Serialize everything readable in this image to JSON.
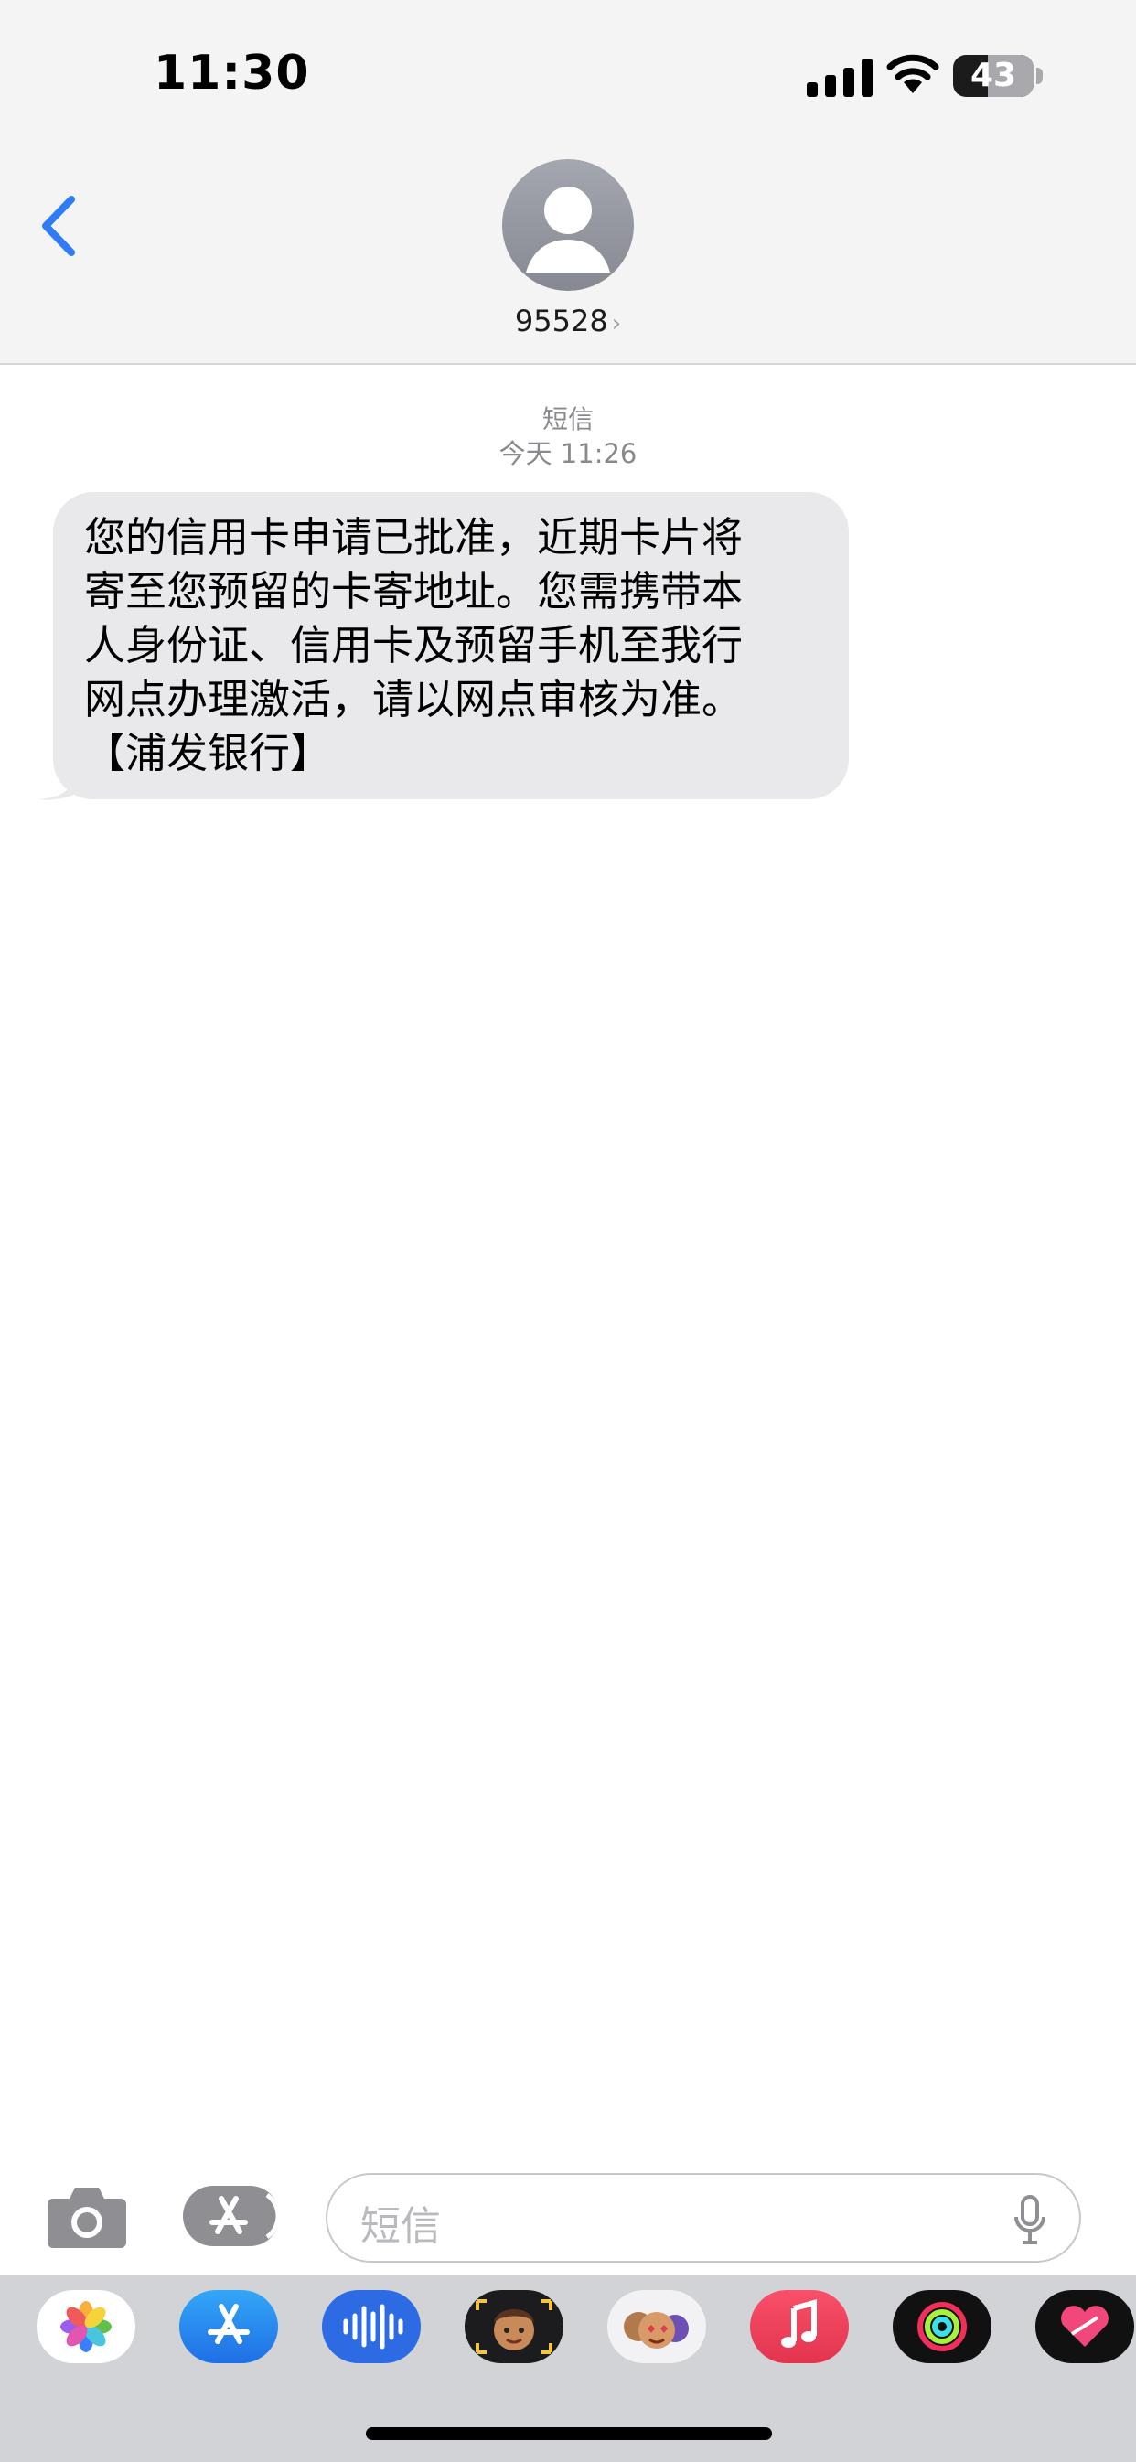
{
  "status_bar": {
    "time": "11:30",
    "battery_percent": "43"
  },
  "header": {
    "contact_name": "95528"
  },
  "conversation": {
    "service_label": "短信",
    "timestamp": "今天 11:26",
    "message": "您的信用卡申请已批准，近期卡片将\n寄至您预留的卡寄地址。您需携带本\n人身份证、信用卡及预留手机至我行\n网点办理激活，请以网点审核为准。\n【浦发银行】"
  },
  "input_bar": {
    "placeholder": "短信"
  },
  "app_drawer": {
    "apps": [
      "photos-icon",
      "app-store-icon",
      "audio-message-icon",
      "memoji-icon",
      "stickers-icon",
      "music-icon",
      "activity-icon",
      "digital-touch-icon"
    ]
  },
  "colors": {
    "accent": "#2f7cf6",
    "bubble": "#e9e9eb",
    "header_bg": "#f4f4f5",
    "drawer_bg": "#d2d3d7"
  }
}
